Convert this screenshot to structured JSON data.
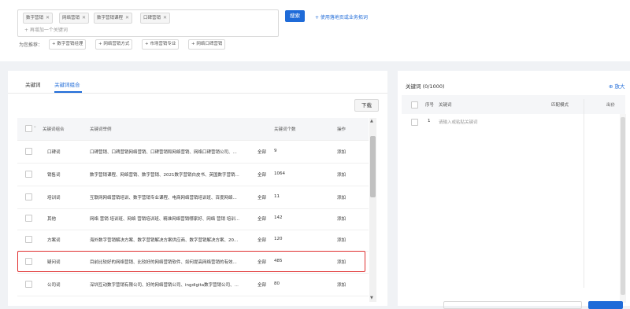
{
  "search": {
    "chips": [
      "数字营销",
      "网络营销",
      "数字营销课程",
      "口碑营销"
    ],
    "add_placeholder": "+ 再增加一个关键词",
    "search_button": "搜索",
    "landing_link": "+ 使用落地页或业务拓词"
  },
  "recommend": {
    "label": "为您推荐：",
    "items": [
      "+ 数字营销经理",
      "+ 网络营销方式",
      "+ 市场营销专业",
      "+ 网络口碑营销"
    ]
  },
  "left": {
    "tabs": [
      "关键词",
      "关键词组合"
    ],
    "download": "下载",
    "headers": {
      "group": "关键词组合",
      "example": "关键词举例",
      "count": "关键词个数",
      "action": "操作"
    },
    "rows": [
      {
        "group": "口碑词",
        "example": "口碑营销、口碑营销网络营销、口碑营销和网络营销、网络口碑营销公司、...",
        "more": "全部",
        "count": "9",
        "action": "添加"
      },
      {
        "group": "销售词",
        "example": "数字营销课程、网络营销、数字营销、2021数字营销白皮书、英国数字营销...",
        "more": "全部",
        "count": "1064",
        "action": "添加"
      },
      {
        "group": "培训词",
        "example": "互联网网络营销培训、数字营销专业课程、电商网络营销培训班、百度网络...",
        "more": "全部",
        "count": "11",
        "action": "添加"
      },
      {
        "group": "其他",
        "example": "网络 营销 培训班、网络 营销培训班、精准网络营销哪家好、网络 营销 培训...",
        "more": "全部",
        "count": "142",
        "action": "添加"
      },
      {
        "group": "方案词",
        "example": "海外数字营销解决方案、数字营销解决方案供应商、数字营销解决方案、20...",
        "more": "全部",
        "count": "120",
        "action": "添加"
      },
      {
        "group": "疑问词",
        "example": "目前比较好的网络营销、比较好的网络营销软件、如何提高网络营销的有效...",
        "more": "全部",
        "count": "485",
        "action": "添加"
      },
      {
        "group": "公司词",
        "example": "深圳互动数字营销有限公司、好的网络营销公司、ingdigita数字营销公司、...",
        "more": "全部",
        "count": "80",
        "action": "添加"
      }
    ]
  },
  "right": {
    "title": "关键词 (0/1000)",
    "zoom": "放大",
    "headers": {
      "seq": "序号",
      "keyword": "关键词",
      "match": "匹配模式",
      "bid": "出价"
    },
    "row": {
      "seq": "1",
      "placeholder": "请输入或粘贴关键词"
    }
  },
  "colors": {
    "accent": "#1f6bd8",
    "highlight": "#e03030"
  }
}
